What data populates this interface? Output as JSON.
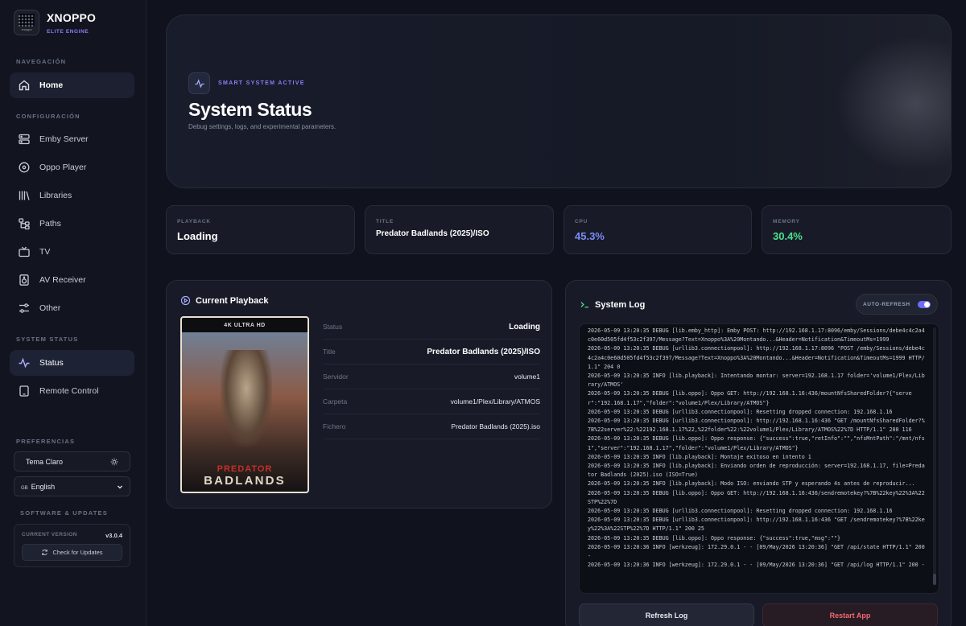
{
  "brand": {
    "name": "XNOPPO",
    "subtitle": "ELITE ENGINE",
    "logo_text": "xnoppo"
  },
  "sidebar": {
    "sections": {
      "navigation": "NAVEGACIÓN",
      "configuration": "CONFIGURACIÓN",
      "system_status": "SYSTEM STATUS",
      "preferences": "PREFERENCIAS",
      "software": "SOFTWARE & UPDATES"
    },
    "items": {
      "home": {
        "label": "Home",
        "icon": "home-icon"
      },
      "emby": {
        "label": "Emby Server",
        "icon": "server-icon"
      },
      "oppo": {
        "label": "Oppo Player",
        "icon": "disc-icon"
      },
      "libraries": {
        "label": "Libraries",
        "icon": "library-icon"
      },
      "paths": {
        "label": "Paths",
        "icon": "paths-icon"
      },
      "tv": {
        "label": "TV",
        "icon": "tv-icon"
      },
      "av": {
        "label": "AV Receiver",
        "icon": "speaker-icon"
      },
      "other": {
        "label": "Other",
        "icon": "sliders-icon"
      },
      "status": {
        "label": "Status",
        "icon": "pulse-icon"
      },
      "remote": {
        "label": "Remote Control",
        "icon": "tablet-icon"
      }
    },
    "theme_label": "Tema Claro",
    "language": {
      "flag": "GB",
      "selected": "English",
      "options": [
        "English"
      ]
    },
    "software": {
      "current_version_label": "CURRENT VERSION",
      "version": "v3.0.4",
      "check_updates": "Check for Updates"
    }
  },
  "hero": {
    "tag": "SMART SYSTEM ACTIVE",
    "title": "System Status",
    "subtitle": "Debug settings, logs, and experimental parameters."
  },
  "stats": [
    {
      "label": "PLAYBACK",
      "value": "Loading",
      "color": "#ffffff"
    },
    {
      "label": "TITLE",
      "value": "Predator Badlands (2025)/ISO",
      "color": "#ffffff"
    },
    {
      "label": "CPU",
      "value": "45.3%",
      "color": "#7b8cf7"
    },
    {
      "label": "MEMORY",
      "value": "30.4%",
      "color": "#4ee08e"
    }
  ],
  "playback": {
    "title": "Current Playback",
    "poster": {
      "band": "4K ULTRA HD",
      "title_top": "PREDATOR",
      "title_bottom": "BADLANDS"
    },
    "rows": [
      {
        "key": "Status",
        "value": "Loading"
      },
      {
        "key": "Title",
        "value": "Predator Badlands (2025)/ISO"
      },
      {
        "key": "Servidor",
        "value": "volume1"
      },
      {
        "key": "Carpeta",
        "value": "volume1/Plex/Library/ATMOS"
      },
      {
        "key": "Fichero",
        "value": "Predator Badlands (2025).iso"
      }
    ]
  },
  "log": {
    "title": "System Log",
    "auto_refresh": "AUTO-REFRESH",
    "lines": [
      "2026-05-09 13:20:35 DEBUG [lib.emby_http]: Emby POST: http://192.168.1.17:8096/emby/Sessions/debe4c4c2a4c0e60d505fd4f53c2f397/Message?Text=Xnoppo%3A%20Montando...&Header=Notification&TimeoutMs=1999",
      "2026-05-09 13:20:35 DEBUG [urllib3.connectionpool]: http://192.168.1.17:8096 \"POST /emby/Sessions/debe4c4c2a4c0e60d505fd4f53c2f397/Message?Text=Xnoppo%3A%20Montando...&Header=Notification&TimeoutMs=1999 HTTP/1.1\" 204 0",
      "2026-05-09 13:20:35 INFO [lib.playback]: Intentando montar: server=192.168.1.17 folder='volume1/Plex/Library/ATMOS'",
      "2026-05-09 13:20:35 DEBUG [lib.oppo]: Oppo GET: http://192.168.1.16:436/mountNfsSharedFolder?{\"server\":\"192.168.1.17\",\"folder\":\"volume1/Plex/Library/ATMOS\"}",
      "2026-05-09 13:20:35 DEBUG [urllib3.connectionpool]: Resetting dropped connection: 192.168.1.16",
      "2026-05-09 13:20:35 DEBUG [urllib3.connectionpool]: http://192.168.1.16:436 \"GET /mountNfsSharedFolder?%7B%22server%22:%22192.168.1.17%22,%22folder%22:%22volume1/Plex/Library/ATMOS%22%7D HTTP/1.1\" 200 116",
      "2026-05-09 13:20:35 DEBUG [lib.oppo]: Oppo response: {\"success\":true,\"retInfo\":\"\",\"nfsMntPath\":\"/mnt/nfs1\",\"server\":\"192.168.1.17\",\"folder\":\"volume1/Plex/Library/ATMOS\"}",
      "2026-05-09 13:20:35 INFO [lib.playback]: Montaje exitoso en intento 1",
      "2026-05-09 13:20:35 INFO [lib.playback]: Enviando orden de reproducción: server=192.168.1.17, file=Predator Badlands (2025).iso (ISO=True)",
      "2026-05-09 13:20:35 INFO [lib.playback]: Modo ISO: enviando STP y esperando 4s antes de reproducir...",
      "2026-05-09 13:20:35 DEBUG [lib.oppo]: Oppo GET: http://192.168.1.16:436/sendremotekey?%7B%22key%22%3A%22STP%22%7D",
      "2026-05-09 13:20:35 DEBUG [urllib3.connectionpool]: Resetting dropped connection: 192.168.1.16",
      "2026-05-09 13:20:35 DEBUG [urllib3.connectionpool]: http://192.168.1.16:436 \"GET /sendremotekey?%7B%22key%22%3A%22STP%22%7D HTTP/1.1\" 200 25",
      "2026-05-09 13:20:35 DEBUG [lib.oppo]: Oppo response: {\"success\":true,\"msg\":\"\"}",
      "2026-05-09 13:20:36 INFO [werkzeug]: 172.29.0.1 - - [09/May/2026 13:20:36] \"GET /api/state HTTP/1.1\" 200 -",
      "2026-05-09 13:20:36 INFO [werkzeug]: 172.29.0.1 - - [09/May/2026 13:20:36] \"GET /api/log HTTP/1.1\" 200 -"
    ],
    "refresh_button": "Refresh Log",
    "restart_button": "Restart App"
  },
  "colors": {
    "accent": "#8b7cf6",
    "cpu": "#7b8cf7",
    "memory": "#4ee08e",
    "danger": "#f06a74"
  }
}
